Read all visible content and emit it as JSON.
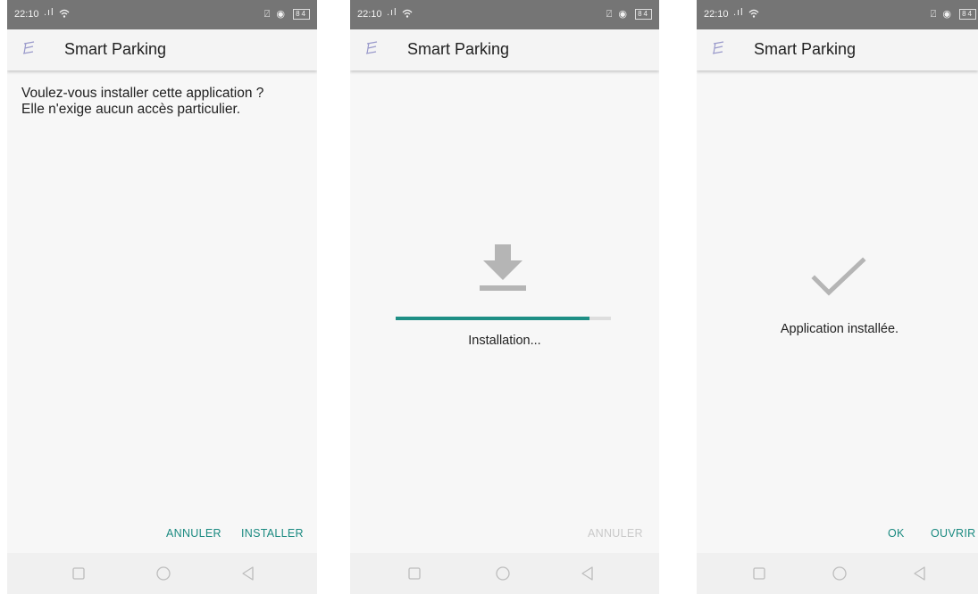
{
  "theme": {
    "accent": "#1a8a80",
    "disabled": "#c9c9c9",
    "status_bar": "#757575",
    "app_bar": "#f4f4f4",
    "screen_bg": "#f7f7f7",
    "icon_gray": "#b5b5b5"
  },
  "screens": [
    {
      "status": {
        "time": "22:10",
        "signal": ".ıl",
        "wifi_icon": "wifi-icon",
        "right_icons": "⍁ ◉",
        "battery": "84"
      },
      "app_bar": {
        "icon": "app-logo-icon",
        "title": "Smart Parking"
      },
      "prompt_line1": "Voulez-vous installer cette application ?",
      "prompt_line2": "Elle n'exige aucun accès particulier.",
      "buttons": {
        "cancel": "ANNULER",
        "install": "INSTALLER"
      }
    },
    {
      "status": {
        "time": "22:10",
        "signal": ".ıl",
        "wifi_icon": "wifi-icon",
        "right_icons": "⍁ ◉",
        "battery": "84"
      },
      "app_bar": {
        "icon": "app-logo-icon",
        "title": "Smart Parking"
      },
      "status_text": "Installation...",
      "progress": 0.9,
      "buttons": {
        "cancel": "ANNULER"
      }
    },
    {
      "status": {
        "time": "22:10",
        "signal": ".ıl",
        "wifi_icon": "wifi-icon",
        "right_icons": "⍁ ◉",
        "battery": "84"
      },
      "app_bar": {
        "icon": "app-logo-icon",
        "title": "Smart Parking"
      },
      "status_text": "Application installée.",
      "buttons": {
        "ok": "OK",
        "open": "OUVRIR"
      }
    }
  ],
  "nav_bar": {
    "icons": [
      "recents-square-icon",
      "home-circle-icon",
      "back-triangle-icon"
    ]
  }
}
